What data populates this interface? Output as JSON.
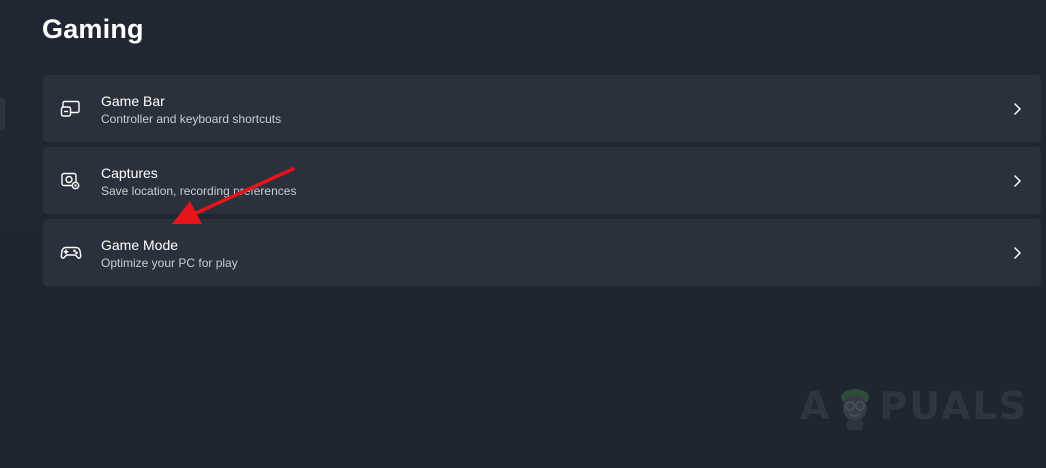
{
  "page": {
    "title": "Gaming"
  },
  "settings": [
    {
      "title": "Game Bar",
      "subtitle": "Controller and keyboard shortcuts",
      "icon": "game-bar-icon"
    },
    {
      "title": "Captures",
      "subtitle": "Save location, recording preferences",
      "icon": "captures-icon"
    },
    {
      "title": "Game Mode",
      "subtitle": "Optimize your PC for play",
      "icon": "gamepad-icon"
    }
  ],
  "watermark": {
    "text_left": "A",
    "text_right": "PUALS"
  },
  "colors": {
    "background": "#1f2631",
    "card": "#2a313c",
    "arrow": "#e8141b",
    "subtitle": "#c9ccd1"
  }
}
